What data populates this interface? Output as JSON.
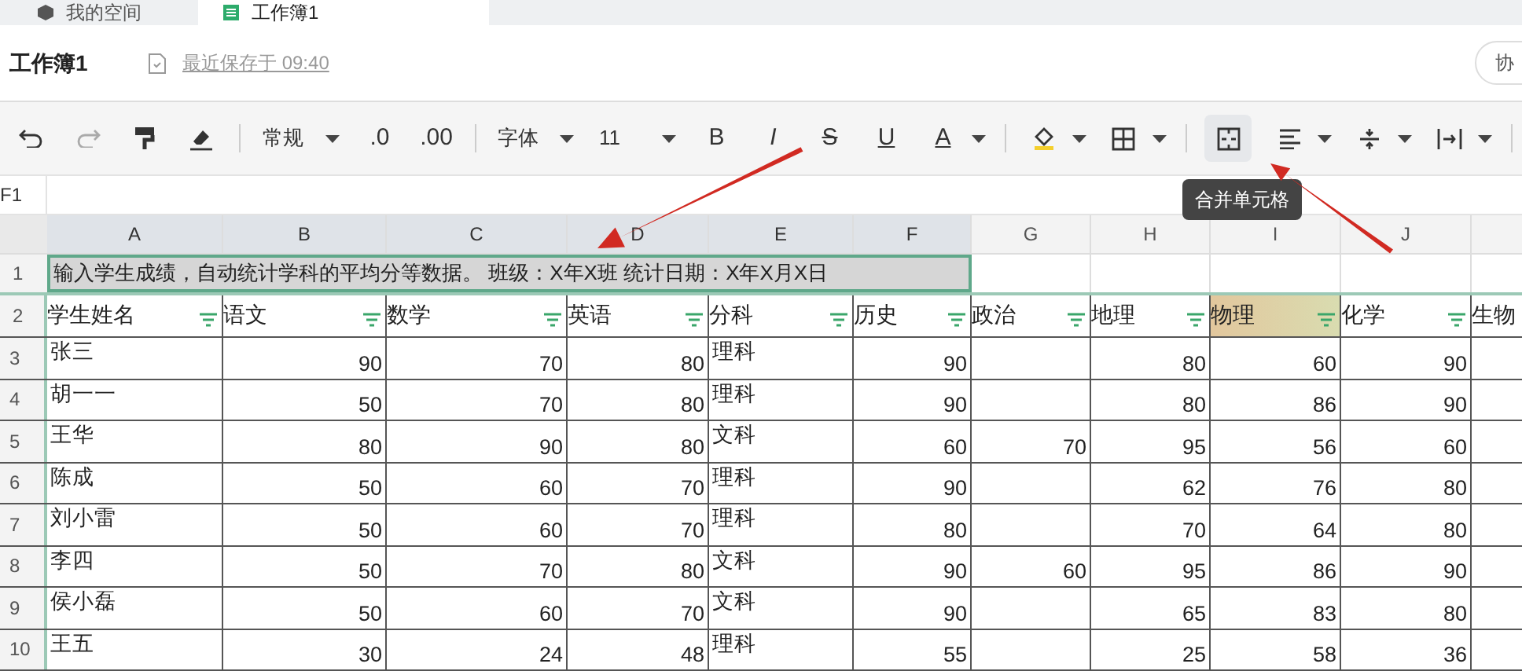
{
  "tabs": [
    {
      "label": "我的空间",
      "kind": "space",
      "selected": false
    },
    {
      "label": "工作簿1",
      "kind": "sheet",
      "selected": true
    }
  ],
  "document": {
    "title": "工作簿1",
    "save_status": "最近保存于 09:40",
    "share_button": "协"
  },
  "toolbar": [
    {
      "kind": "undo"
    },
    {
      "kind": "redo"
    },
    {
      "kind": "painter"
    },
    {
      "kind": "eraser"
    },
    {
      "kind": "separator"
    },
    {
      "kind": "dropdown",
      "label": "常规"
    },
    {
      "kind": "glyph",
      "label": ".0"
    },
    {
      "kind": "glyph",
      "label": ".00"
    },
    {
      "kind": "separator"
    },
    {
      "kind": "dropdown",
      "label": "字体"
    },
    {
      "kind": "dropdown",
      "label": "11"
    },
    {
      "kind": "glyph",
      "label": "B"
    },
    {
      "kind": "glyph",
      "label": "I",
      "italic": true
    },
    {
      "kind": "glyph",
      "label": "S",
      "strike": true
    },
    {
      "kind": "glyph",
      "label": "U",
      "underline": true
    },
    {
      "kind": "glyph",
      "label": "A",
      "underline": true,
      "caret": true
    },
    {
      "kind": "separator"
    },
    {
      "kind": "fill",
      "caret": true
    },
    {
      "kind": "border",
      "caret": true
    },
    {
      "kind": "separator"
    },
    {
      "kind": "merge",
      "selected": true
    },
    {
      "kind": "align",
      "caret": true
    },
    {
      "kind": "valign",
      "caret": true
    },
    {
      "kind": "wrap",
      "caret": true
    },
    {
      "kind": "separator"
    }
  ],
  "tooltip": "合并单元格",
  "cell_reference": "F1",
  "columns": [
    {
      "label": "A",
      "selected": true,
      "kind": "text"
    },
    {
      "label": "B",
      "selected": true,
      "kind": "number"
    },
    {
      "label": "C",
      "selected": true,
      "kind": "number"
    },
    {
      "label": "D",
      "selected": true,
      "kind": "number"
    },
    {
      "label": "E",
      "selected": true,
      "kind": "text"
    },
    {
      "label": "F",
      "selected": true,
      "kind": "number"
    },
    {
      "label": "G",
      "selected": false,
      "kind": "number"
    },
    {
      "label": "H",
      "selected": false,
      "kind": "number"
    },
    {
      "label": "I",
      "selected": false,
      "kind": "number"
    },
    {
      "label": "J",
      "selected": false,
      "kind": "number"
    }
  ],
  "merged_row": {
    "number": "1",
    "text": "输入学生成绩，自动统计学科的平均分等数据。 班级：X年X班 统计日期：X年X月X日"
  },
  "header_row": {
    "number": "2",
    "cells": [
      {
        "text": "学生姓名",
        "highlighted": false
      },
      {
        "text": "语文",
        "highlighted": false
      },
      {
        "text": "数学",
        "highlighted": false
      },
      {
        "text": "英语",
        "highlighted": false
      },
      {
        "text": "分科",
        "highlighted": false
      },
      {
        "text": "历史",
        "highlighted": false
      },
      {
        "text": "政治",
        "highlighted": false
      },
      {
        "text": "地理",
        "highlighted": false
      },
      {
        "text": "物理",
        "highlighted": true
      },
      {
        "text": "化学",
        "highlighted": false
      },
      {
        "text": "生物",
        "highlighted": false
      }
    ]
  },
  "rows": [
    {
      "number": "3",
      "cells": [
        "张三",
        "90",
        "70",
        "80",
        "理科",
        "90",
        null,
        "80",
        "60",
        "90"
      ]
    },
    {
      "number": "4",
      "cells": [
        "胡一一",
        "50",
        "70",
        "80",
        "理科",
        "90",
        null,
        "80",
        "86",
        "90"
      ]
    },
    {
      "number": "5",
      "cells": [
        "王华",
        "80",
        "90",
        "80",
        "文科",
        "60",
        "70",
        "95",
        "56",
        "60"
      ]
    },
    {
      "number": "6",
      "cells": [
        "陈成",
        "50",
        "60",
        "70",
        "理科",
        "90",
        null,
        "62",
        "76",
        "80"
      ]
    },
    {
      "number": "7",
      "cells": [
        "刘小雷",
        "50",
        "60",
        "70",
        "理科",
        "80",
        null,
        "70",
        "64",
        "80"
      ]
    },
    {
      "number": "8",
      "cells": [
        "李四",
        "50",
        "70",
        "80",
        "文科",
        "90",
        "60",
        "95",
        "86",
        "90"
      ]
    },
    {
      "number": "9",
      "cells": [
        "侯小磊",
        "50",
        "60",
        "70",
        "文科",
        "90",
        null,
        "65",
        "83",
        "80"
      ]
    },
    {
      "number": "10",
      "cells": [
        "王五",
        "30",
        "24",
        "48",
        "理科",
        "55",
        null,
        "25",
        "58",
        "36"
      ]
    }
  ],
  "annotations": [
    {
      "kind": "arrow"
    },
    {
      "kind": "arrow"
    }
  ]
}
